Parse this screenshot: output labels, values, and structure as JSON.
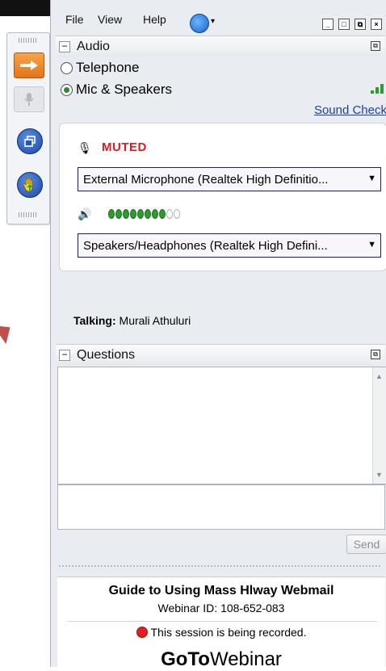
{
  "menu": {
    "file": "File",
    "view": "View",
    "help": "Help"
  },
  "window_controls": {
    "minimize": "_",
    "restore": "□",
    "popout": "⧉",
    "close": "×"
  },
  "audio": {
    "title": "Audio",
    "telephone_label": "Telephone",
    "mic_speakers_label": "Mic & Speakers",
    "selected_mode": "Mic & Speakers",
    "sound_check_label": "Sound Check",
    "mic_status": "MUTED",
    "microphone_device": "External Microphone (Realtek High Definitio...",
    "speaker_device": "Speakers/Headphones (Realtek High Defini...",
    "speaker_level": {
      "lit": 8,
      "total": 10
    }
  },
  "talking": {
    "label": "Talking:",
    "name": "Murali Athuluri"
  },
  "questions": {
    "title": "Questions",
    "input_value": "",
    "send_label": "Send"
  },
  "webinar": {
    "title": "Guide to Using Mass Hlway Webmail",
    "id_label": "Webinar ID: 108-652-083",
    "recording_text": "This session is being recorded.",
    "brand_bold": "GoTo",
    "brand_light": "Webinar"
  },
  "colors": {
    "muted": "#e01b1b",
    "level_on": "#2d9b2d",
    "link": "#1a3fa8",
    "recording": "#e02020"
  }
}
